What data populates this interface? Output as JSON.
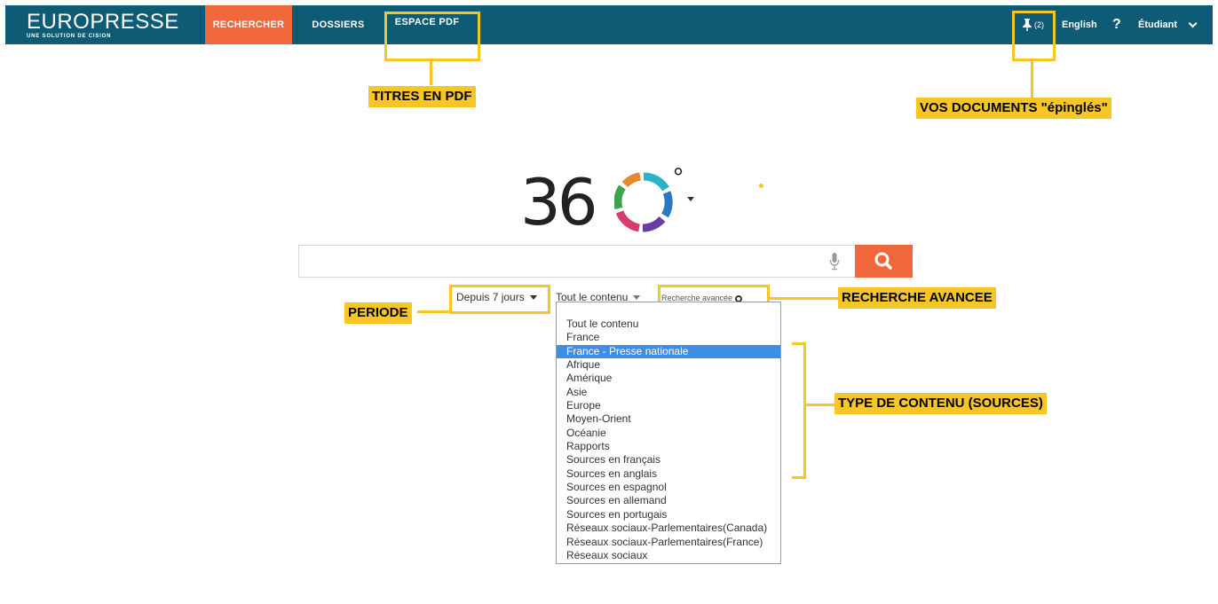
{
  "colors": {
    "topbar": "#0e5b76",
    "accent": "#f0673b",
    "annotation": "#f6c526",
    "selection": "#3d8ee6"
  },
  "header": {
    "logo_main": "EUROPRESSE",
    "logo_sub": "UNE SOLUTION DE CISION",
    "nav": {
      "rechercher": "RECHERCHER",
      "dossiers": "DOSSIERS",
      "espace_pdf": "ESPACE PDF"
    },
    "pin_icon": "pin-icon",
    "pin_count": "(2)",
    "language": "English",
    "help": "?",
    "user": "Étudiant"
  },
  "annotations": {
    "titres_pdf": "TITRES EN PDF",
    "vos_documents": "VOS DOCUMENTS \"épinglés\"",
    "periode": "PERIODE",
    "recherche_avancee": "RECHERCHE AVANCEE",
    "type_contenu": "TYPE DE CONTENU (SOURCES)"
  },
  "brand360": {
    "text": "36",
    "degree": "°"
  },
  "search": {
    "placeholder": "",
    "value": "",
    "mic_icon": "microphone-icon",
    "search_icon": "search-icon"
  },
  "filters": {
    "periode": "Depuis 7 jours",
    "contenu": "Tout le contenu",
    "avancee": "Recherche avancée"
  },
  "dropdown": {
    "selected_index": 2,
    "options": [
      "Tout le contenu",
      "France",
      "France - Presse nationale",
      "Afrique",
      "Amérique",
      "Asie",
      "Europe",
      "Moyen-Orient",
      "Océanie",
      "Rapports",
      "Sources en français",
      "Sources en anglais",
      "Sources en espagnol",
      "Sources en allemand",
      "Sources en portugais",
      "Réseaux sociaux-Parlementaires(Canada)",
      "Réseaux sociaux-Parlementaires(France)",
      "Réseaux sociaux"
    ]
  }
}
